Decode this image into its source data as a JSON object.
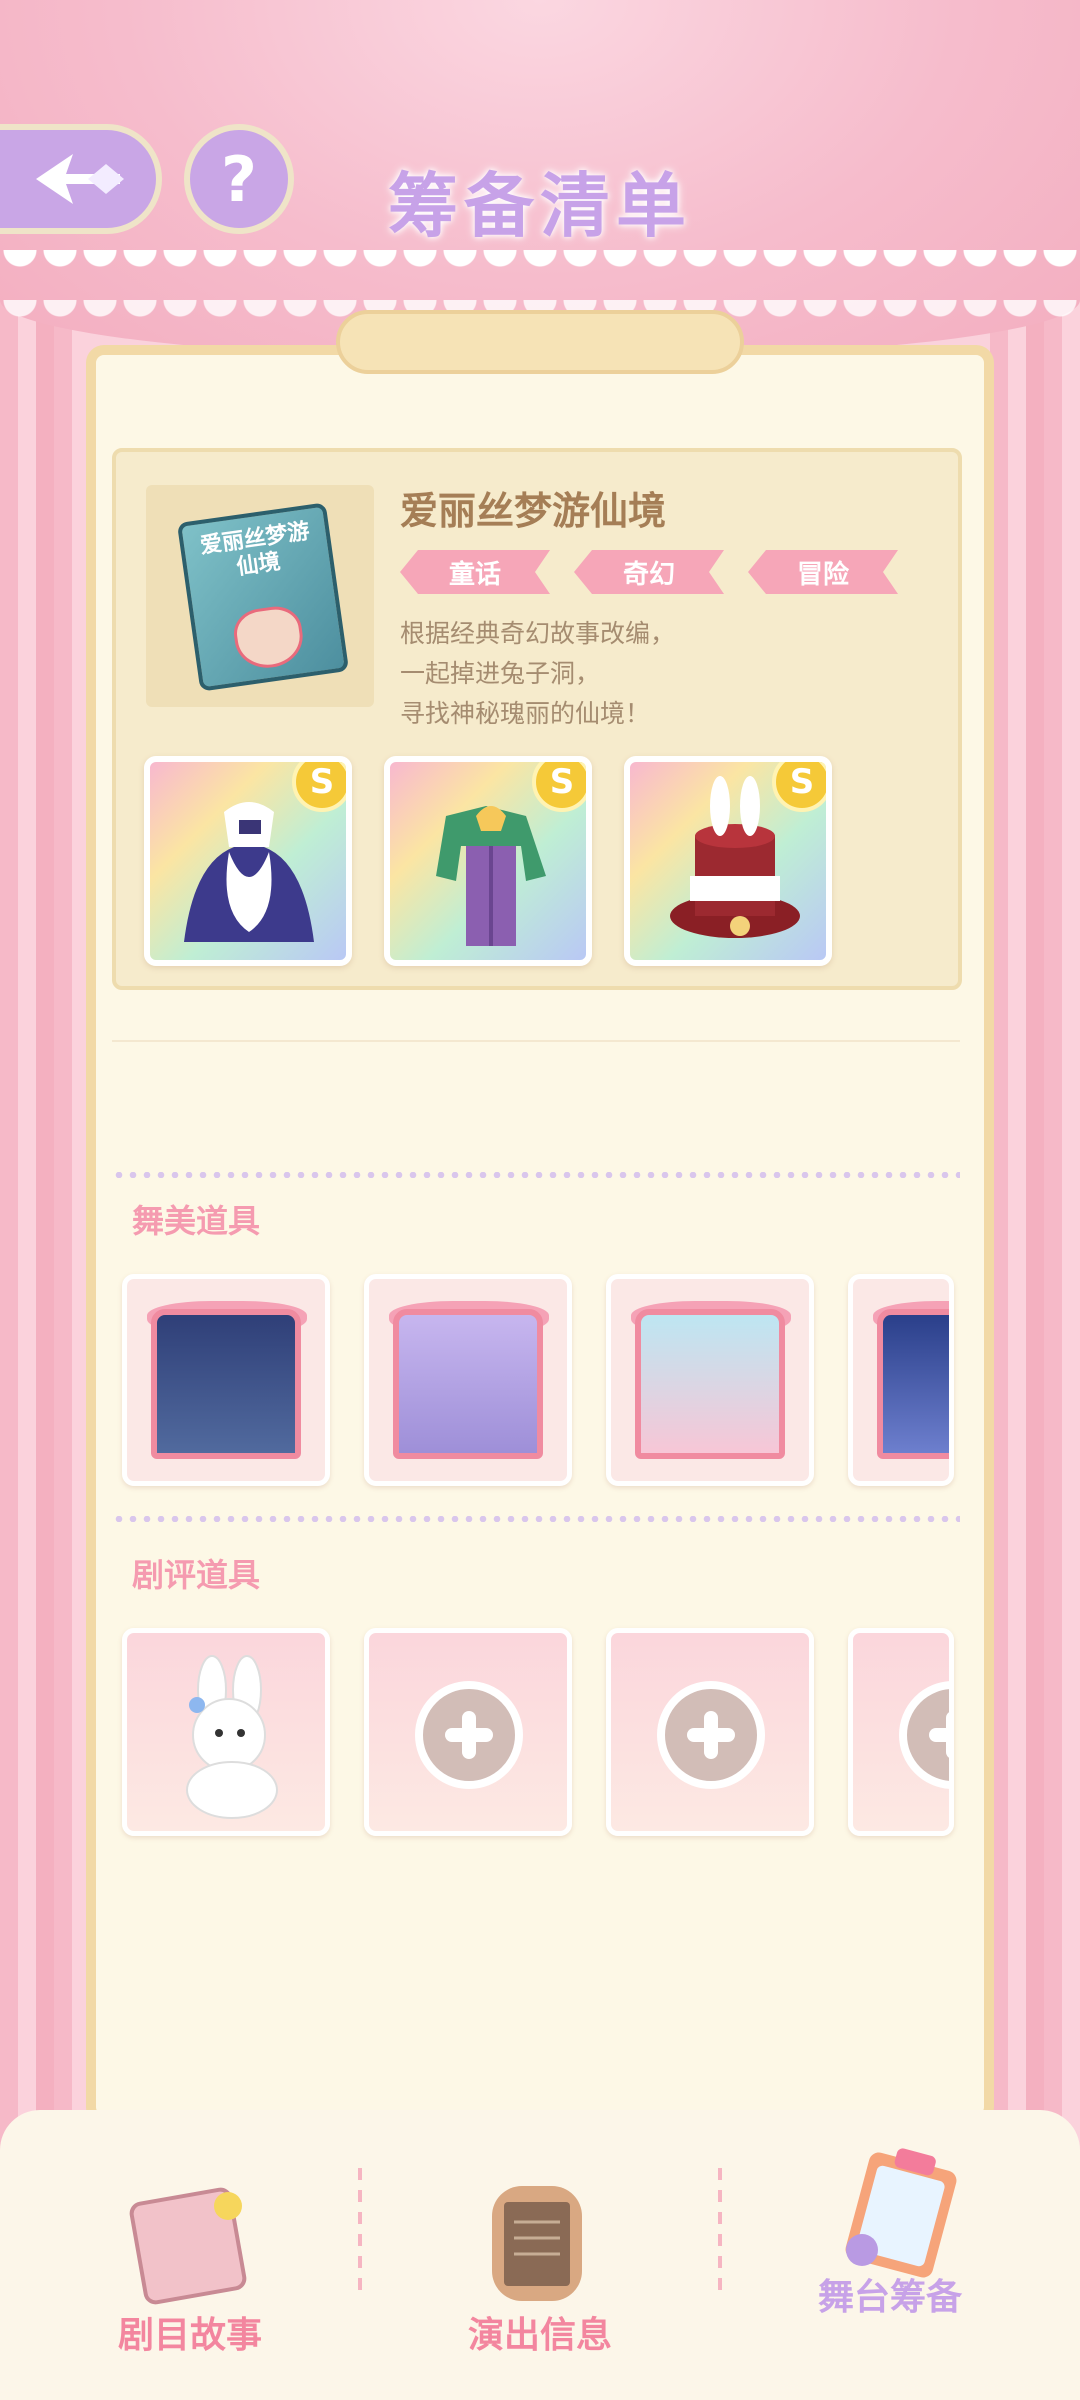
{
  "header": {
    "title": "筹备清单",
    "help_symbol": "?"
  },
  "story": {
    "cover_text": "爱丽丝梦游仙境",
    "title": "爱丽丝梦游仙境",
    "tags": [
      "童话",
      "奇幻",
      "冒险"
    ],
    "description": "根据经典奇幻故事改编，\n一起掉进兔子洞，\n寻找神秘瑰丽的仙境！",
    "costume_badge": "S"
  },
  "stage_props": {
    "label": "舞美道具"
  },
  "review_props": {
    "label": "剧评道具"
  },
  "nav": {
    "items": [
      "剧目故事",
      "演出信息",
      "舞台筹备"
    ],
    "active_index": 2
  },
  "colors": {
    "accent_purple": "#c7a2e8",
    "accent_pink": "#f3869f",
    "tag_pink": "#f6a6b8",
    "coin_gold": "#f5c938"
  }
}
